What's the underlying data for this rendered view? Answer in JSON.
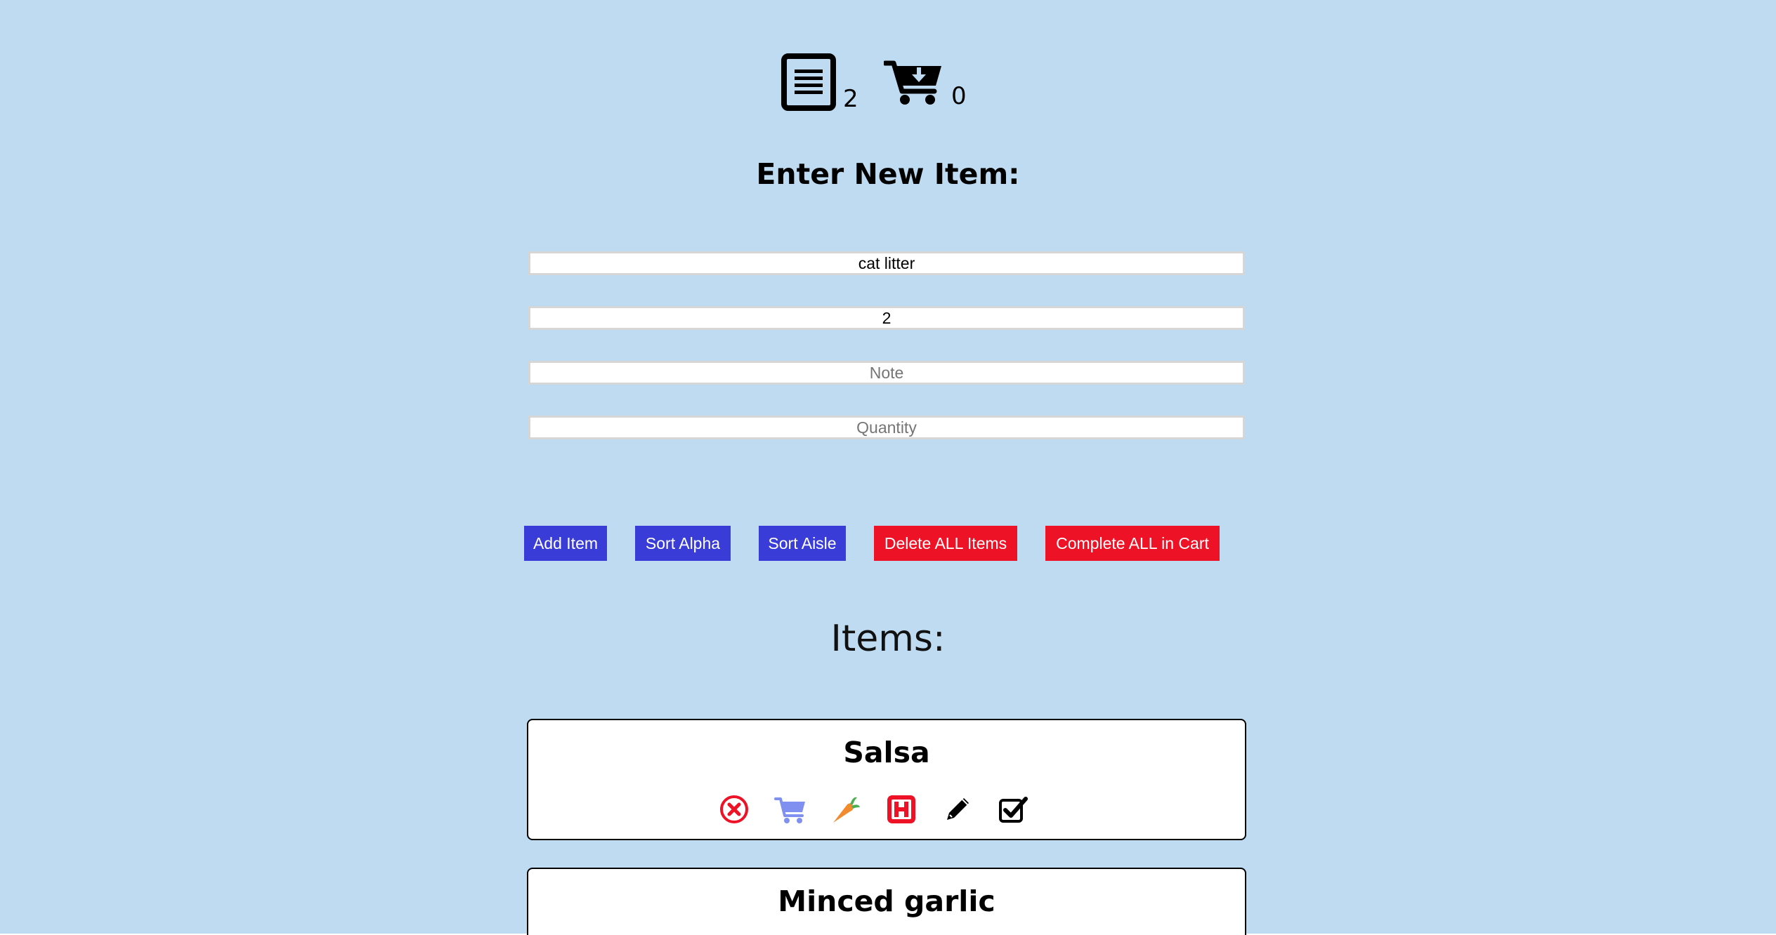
{
  "header": {
    "list_count": "2",
    "cart_count": "0",
    "list_icon": "list-document-icon",
    "cart_icon": "cart-download-icon"
  },
  "form": {
    "title": "Enter New Item:",
    "name_value": "cat litter",
    "aisle_value": "2",
    "note_placeholder": "Note",
    "quantity_placeholder": "Quantity"
  },
  "buttons": {
    "add_item": "Add Item",
    "sort_alpha": "Sort Alpha",
    "sort_aisle": "Sort Aisle",
    "delete_all": "Delete ALL Items",
    "complete_all": "Complete ALL in Cart"
  },
  "items_heading": "Items:",
  "items": [
    {
      "name": "Salsa",
      "actions": [
        "delete-circle-x-icon",
        "cart-icon",
        "carrot-icon",
        "h-store-icon",
        "pencil-edit-icon",
        "check-box-icon"
      ]
    },
    {
      "name": "Minced garlic"
    }
  ],
  "colors": {
    "page_background": "#bedbf2",
    "button_blue": "#3a3cd8",
    "button_red": "#ee1226",
    "delete_icon": "#ee1226",
    "cart_icon": "#7f90f0",
    "carrot": "#f28a2e",
    "carrot_leaves": "#4caf50"
  }
}
